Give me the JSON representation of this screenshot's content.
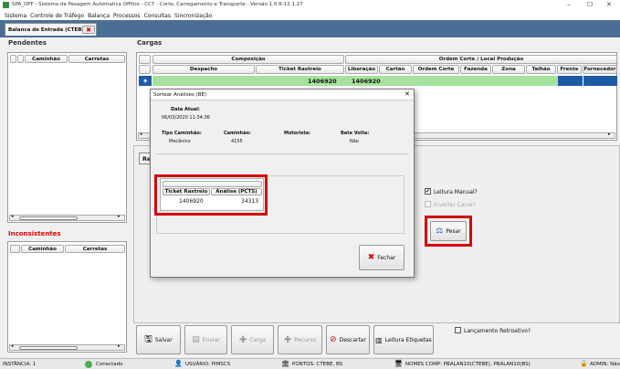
{
  "window": {
    "title": "SPA_OFF - Sistema de Pesagem Automatica Offline - CCT - Corte, Carregamento e Transporte - Versão 1.0 R-12.1.27",
    "minimize": "–",
    "maximize": "☐",
    "close": "✕"
  },
  "menu": [
    "Sistema",
    "Controle de Tráfego",
    "Balança",
    "Processos",
    "Consultas",
    "Sincronização"
  ],
  "tab": {
    "label": "Balanca de Entrada (CTEBE)"
  },
  "pendentes": {
    "title": "Pendentes",
    "col_caminhao": "Caminhão",
    "col_carretas": "Carretas"
  },
  "inconsistentes": {
    "title": "Inconsistentes",
    "col_caminhao": "Caminhão",
    "col_carretas": "Carretas"
  },
  "cargas": {
    "title": "Cargas",
    "group_composicao": "Composição",
    "group_ordem": "Ordem Corte / Local Produção",
    "cols": [
      "Despacho",
      "Ticket Rastreio",
      "Liberação",
      "Cartão",
      "Ordem Corte",
      "Fazenda",
      "Zona",
      "Talhão",
      "Frente",
      "Fornecedor"
    ],
    "row": {
      "ticket": "1406920",
      "liberacao": "1406920"
    }
  },
  "re_tab": "Re",
  "dialog": {
    "title": "Sortear Análises (BE)",
    "data_atual_label": "Data Atual:",
    "data_atual_value": "06/03/2020 11:34:36",
    "tipo_caminhao_label": "Tipo Caminhão:",
    "tipo_caminhao_value": "Mecânico",
    "caminhao_label": "Caminhão:",
    "caminhao_value": "4155",
    "motorista_label": "Motorista:",
    "motorista_value": "",
    "bate_volta_label": "Bate Volta:",
    "bate_volta_value": "Não",
    "col_ticket": "Ticket Rastreio",
    "col_analise": "Análise (PCTS)",
    "ticket_value": "1406920",
    "analise_value": "34313",
    "fechar": "Fechar"
  },
  "right": {
    "leitura_manual": "Leitura Manual?",
    "inverter_canal": "Inverter Canal?",
    "pesar": "Pesar"
  },
  "toolbar": {
    "salvar": "Salvar",
    "enviar": "Enviar",
    "carga": "Carga",
    "recurso": "Recurso",
    "descartar": "Descartar",
    "leitura_etiquetas": "Leitura Etiquetas",
    "lancamento": "Lançamento Retroativo?"
  },
  "status": {
    "instancia": "INSTÂNCIA: 1",
    "conectado": "Conectado",
    "usuario": "USUÁRIO: PIMSCS",
    "pontos": "PONTOS: CTEBE, BS",
    "nomes": "NOMES COMP: PBALAN10(CTEBE), PBALAN10(BS)",
    "admin": "ADMIN: Não"
  },
  "colors": {
    "highlight_red": "#d4000c",
    "row_green": "#a6e29e",
    "row_blue": "#1f5aa6",
    "tabbar": "#4a6f95"
  }
}
